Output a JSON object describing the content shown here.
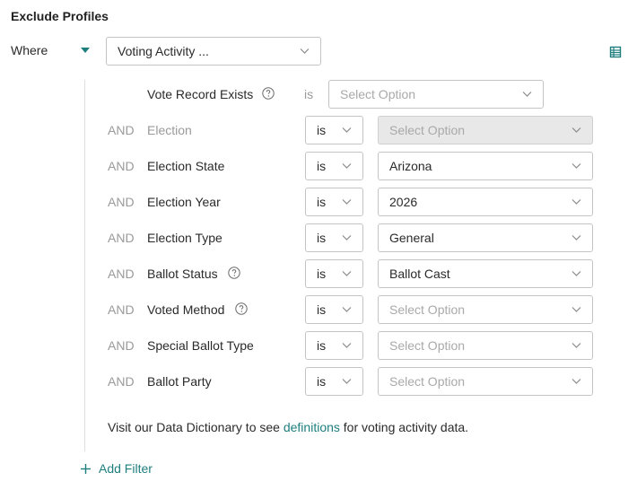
{
  "section_title": "Exclude Profiles",
  "where_label": "Where",
  "filter_select": {
    "value": "Voting Activity ..."
  },
  "first_row": {
    "label": "Vote Record Exists",
    "operator": "is",
    "placeholder": "Select Option"
  },
  "conjunction": "AND",
  "rows": [
    {
      "label": "Election",
      "operator": "is",
      "value": "Select Option"
    },
    {
      "label": "Election State",
      "operator": "is",
      "value": "Arizona"
    },
    {
      "label": "Election Year",
      "operator": "is",
      "value": "2026"
    },
    {
      "label": "Election Type",
      "operator": "is",
      "value": "General"
    },
    {
      "label": "Ballot Status",
      "operator": "is",
      "value": "Ballot Cast"
    },
    {
      "label": "Voted Method",
      "operator": "is",
      "value": "Select Option"
    },
    {
      "label": "Special Ballot Type",
      "operator": "is",
      "value": "Select Option"
    },
    {
      "label": "Ballot Party",
      "operator": "is",
      "value": "Select Option"
    }
  ],
  "note": {
    "before": "Visit our Data Dictionary to see ",
    "link": "definitions",
    "after": " for voting activity data."
  },
  "add_filter_label": "Add Filter",
  "colors": {
    "accent": "#1f7e7e",
    "muted": "#9a9a9a",
    "border": "#c4c4c4",
    "disabled_bg": "#e8e8e8"
  }
}
